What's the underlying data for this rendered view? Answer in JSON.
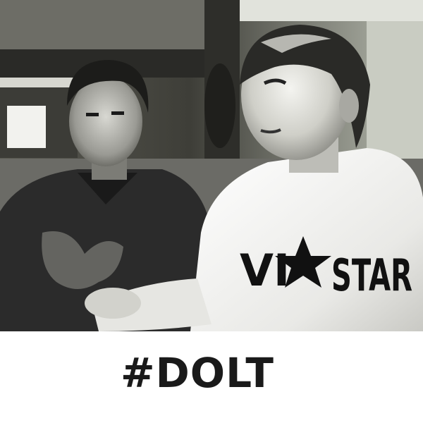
{
  "photo": {
    "shirt_text_left": "VI",
    "shirt_text_right": "STAR"
  },
  "caption": {
    "text": "#DOLT"
  },
  "colors": {
    "background": "#ffffff",
    "caption": "#1a1a1a"
  }
}
